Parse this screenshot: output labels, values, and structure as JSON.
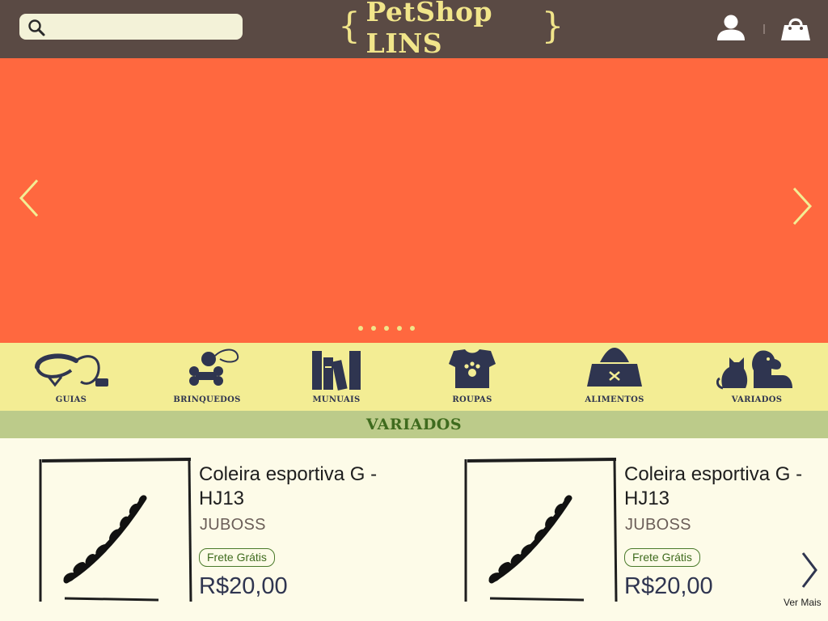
{
  "header": {
    "search_placeholder": "",
    "logo_text": "PetShop LINS",
    "logo_brace_open": "{",
    "logo_brace_close": "}",
    "colors": {
      "bar": "#5a4a44",
      "logo": "#f1e58a",
      "search_bg": "#f3f2d8"
    },
    "icons": [
      "search-icon",
      "user-icon",
      "cart-icon"
    ]
  },
  "banner": {
    "background": "#ff683f",
    "slide_count": 5,
    "icons": [
      "chevron-left-icon",
      "chevron-right-icon"
    ]
  },
  "categories": {
    "items": [
      {
        "label": "GUIAS",
        "icon": "leash-icon"
      },
      {
        "label": "BRINQUEDOS",
        "icon": "bone-toy-icon"
      },
      {
        "label": "MUNUAIS",
        "icon": "books-icon"
      },
      {
        "label": "ROUPAS",
        "icon": "pet-shirt-icon"
      },
      {
        "label": "ALIMENTOS",
        "icon": "food-bowl-icon"
      },
      {
        "label": "VARIADOS",
        "icon": "cat-dog-icon"
      }
    ]
  },
  "section": {
    "title": "VARIADOS"
  },
  "products": {
    "items": [
      {
        "name": "Coleira esportiva G - HJ13",
        "brand": "JUBOSS",
        "badge": "Frete Grátis",
        "price": "R$20,00"
      },
      {
        "name": "Coleira esportiva G - HJ13",
        "brand": "JUBOSS",
        "badge": "Frete Grátis",
        "price": "R$20,00"
      }
    ],
    "more_label": "Ver Mais"
  }
}
